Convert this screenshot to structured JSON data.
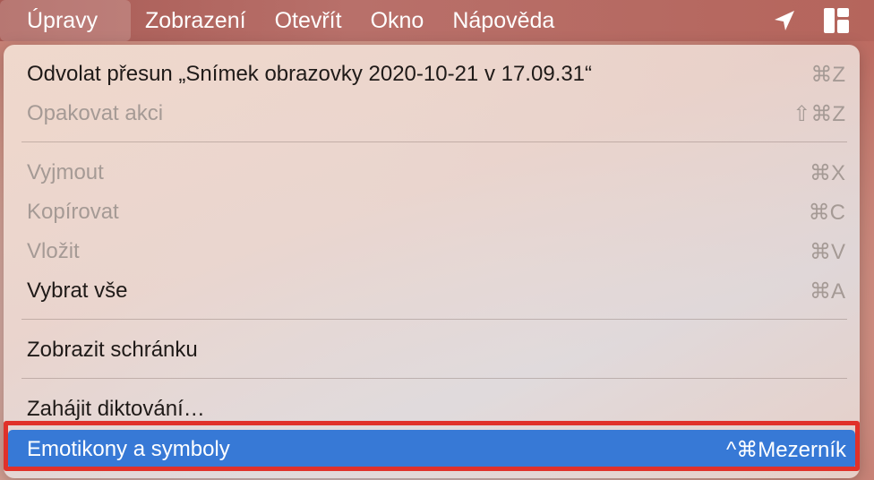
{
  "menubar": {
    "items": [
      {
        "label": "Úpravy",
        "active": true
      },
      {
        "label": "Zobrazení"
      },
      {
        "label": "Otevřít"
      },
      {
        "label": "Okno"
      },
      {
        "label": "Nápověda"
      }
    ],
    "status_icons": [
      "location-arrow-icon",
      "layout-panels-icon"
    ]
  },
  "menu": {
    "items": [
      {
        "label": "Odvolat přesun „Snímek obrazovky 2020-10-21 v 17.09.31“",
        "shortcut": "⌘Z",
        "enabled": true
      },
      {
        "label": "Opakovat akci",
        "shortcut": "⇧⌘Z",
        "enabled": false
      },
      {
        "label": "Vyjmout",
        "shortcut": "⌘X",
        "enabled": false
      },
      {
        "label": "Kopírovat",
        "shortcut": "⌘C",
        "enabled": false
      },
      {
        "label": "Vložit",
        "shortcut": "⌘V",
        "enabled": false
      },
      {
        "label": "Vybrat vše",
        "shortcut": "⌘A",
        "enabled": true
      },
      {
        "label": "Zobrazit schránku",
        "shortcut": "",
        "enabled": true
      },
      {
        "label": "Zahájit diktování…",
        "shortcut": "",
        "enabled": true
      },
      {
        "label": "Emotikony a symboly",
        "shortcut": "^⌘Mezerník",
        "enabled": true,
        "highlighted": true
      }
    ]
  },
  "colors": {
    "highlight": "#3779d6",
    "annotation_frame": "#e0312a"
  }
}
